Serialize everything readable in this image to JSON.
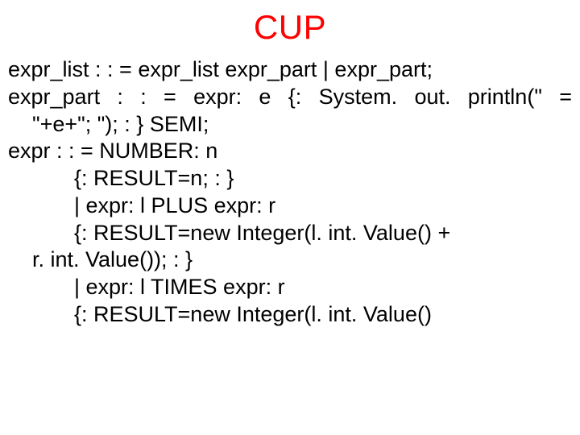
{
  "title": "CUP",
  "lines": {
    "l0": "expr_list : : = expr_list expr_part | expr_part;",
    "l1": "expr_part  : : =  expr: e  {:  System. out. println(\"  =",
    "l2": "\"+e+\"; \"); : } SEMI;",
    "l3": "expr      : : = NUMBER: n",
    "l4": "{: RESULT=n; : }",
    "l5": "| expr: l PLUS expr: r",
    "l6": "{: RESULT=new Integer(l. int. Value() +",
    "l7": "r. int. Value()); : }",
    "l8": "| expr: l TIMES expr: r",
    "l9": "{: RESULT=new Integer(l. int. Value()"
  }
}
